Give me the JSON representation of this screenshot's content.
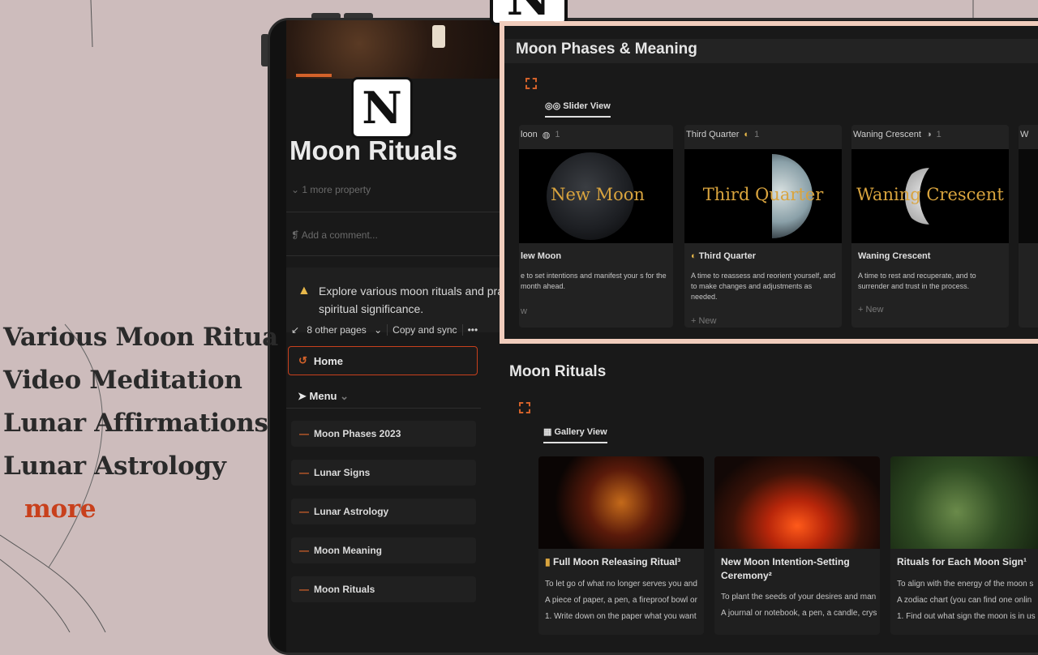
{
  "promo": {
    "items": [
      "Various Moon Ritua",
      "Video Meditation",
      "Lunar Affirmations",
      "Lunar Astrology"
    ],
    "more": "more"
  },
  "logo_letter": "N",
  "page": {
    "title": "Moon Rituals",
    "more_property": "1 more property",
    "add_comment": "Add a comment...",
    "callout_text": "Explore various moon rituals and prac spiritual significance.",
    "sync": {
      "other_pages": "8 other pages",
      "copy_sync": "Copy and sync",
      "more": "•••"
    },
    "home": "Home",
    "menu": "Menu",
    "menu_items": [
      "Moon Phases 2023",
      "Lunar Signs",
      "Lunar Astrology",
      "Moon Meaning",
      "Moon Rituals"
    ]
  },
  "phases": {
    "title": "Moon Phases & Meaning",
    "view": "Slider View",
    "cards": [
      {
        "group": "loon",
        "count": "1",
        "image_label": "New Moon",
        "name": "lew Moon",
        "desc": "e to set intentions and manifest your s for the month ahead.",
        "new": "w"
      },
      {
        "group": "Third Quarter",
        "count": "1",
        "image_label": "Third Quarter",
        "name": "Third Quarter",
        "desc": "A time to reassess and reorient yourself, and to make changes and adjustments as needed.",
        "new": "+ New"
      },
      {
        "group": "Waning Crescent",
        "count": "1",
        "image_label": "Waning Crescent",
        "name": "Waning Crescent",
        "desc": "A time to rest and recuperate, and to surrender and trust in the process.",
        "new": "+ New"
      }
    ],
    "partial_head": "W"
  },
  "rituals": {
    "title": "Moon Rituals",
    "view": "Gallery View",
    "cards": [
      {
        "name": "Full Moon Releasing Ritual³",
        "line1": "To let go of what no longer serves you and",
        "line2": "A piece of paper, a pen, a fireproof bowl or",
        "line3": "1. Write down on the paper what you want"
      },
      {
        "name": "New Moon Intention-Setting Ceremony²",
        "line1": "To plant the seeds of your desires and man",
        "line2": "A journal or notebook, a pen, a candle, crys",
        "line3": ""
      },
      {
        "name": "Rituals for Each Moon Sign¹",
        "line1": "To align with the energy of the moon s",
        "line2": "A zodiac chart (you can find one onlin",
        "line3": "1. Find out what sign the moon is in us"
      }
    ]
  },
  "colors": {
    "accent": "#d4622a",
    "promo_more": "#c8401c",
    "gold": "#d9a43e"
  }
}
